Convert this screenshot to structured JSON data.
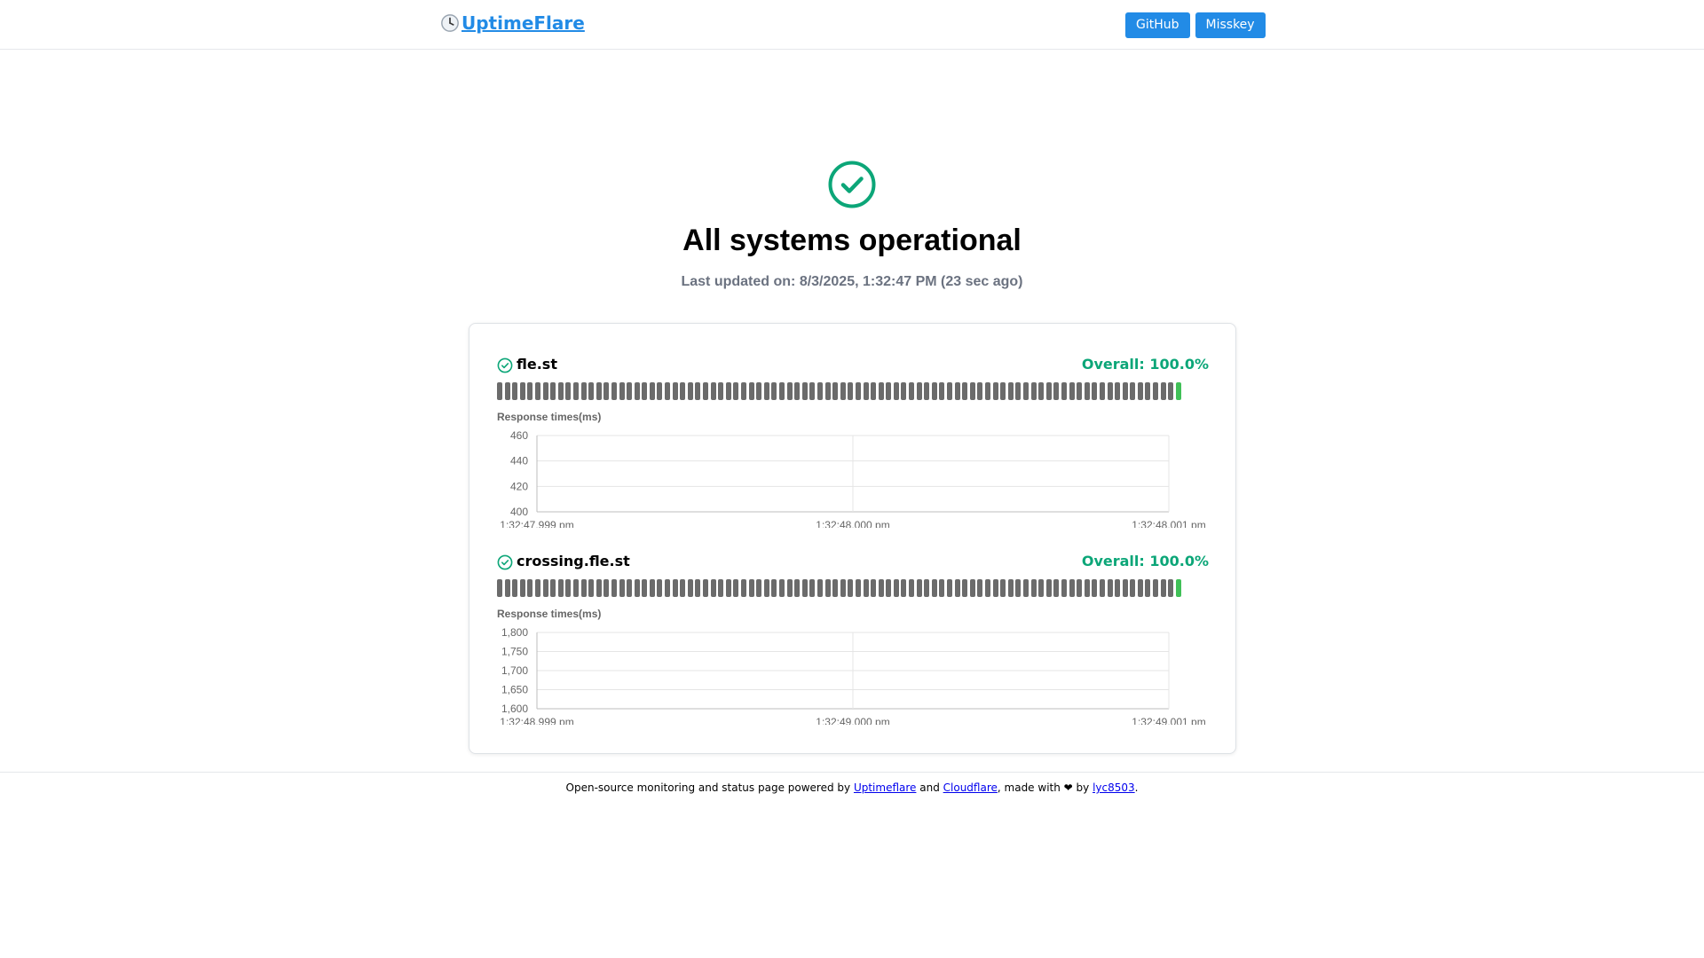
{
  "header": {
    "brand": "UptimeFlare",
    "brand_icon": "clock-icon",
    "nav": [
      "GitHub",
      "Misskey"
    ],
    "accent_color": "#228be6"
  },
  "hero": {
    "status_icon": "check-circle-icon",
    "title": "All systems operational",
    "last_updated": "Last updated on: 8/3/2025, 1:32:47 PM (23 sec ago)",
    "status_color": "#0ca678"
  },
  "monitors": [
    {
      "name": "fle.st",
      "overall": "Overall: 100.0%",
      "bar_colors": {
        "unknown": "#6b6b6b",
        "up": "#40c057"
      },
      "bars_total": 90,
      "bars_up": 1,
      "response_label": "Response times(ms)",
      "chart_data": {
        "type": "line",
        "title": "Response times(ms)",
        "x": [
          "1:32:47.999 pm",
          "1:32:48.000 pm",
          "1:32:48.001 pm"
        ],
        "series": [],
        "ylim": [
          400,
          460
        ],
        "yticks": [
          "460",
          "440",
          "420",
          "400"
        ],
        "grid": true
      }
    },
    {
      "name": "crossing.fle.st",
      "overall": "Overall: 100.0%",
      "bar_colors": {
        "unknown": "#6b6b6b",
        "up": "#40c057"
      },
      "bars_total": 90,
      "bars_up": 1,
      "response_label": "Response times(ms)",
      "chart_data": {
        "type": "line",
        "title": "Response times(ms)",
        "x": [
          "1:32:48.999 pm",
          "1:32:49.000 pm",
          "1:32:49.001 pm"
        ],
        "series": [],
        "ylim": [
          1600,
          1800
        ],
        "yticks": [
          "1,800",
          "1,750",
          "1,700",
          "1,650",
          "1,600"
        ],
        "grid": true
      }
    }
  ],
  "footer": {
    "text_before": "Open-source monitoring and status page powered by ",
    "link1": "Uptimeflare",
    "and": " and ",
    "link2": "Cloudflare",
    "made_with": ", made with ❤ by ",
    "link3": "lyc8503",
    "end": "."
  }
}
